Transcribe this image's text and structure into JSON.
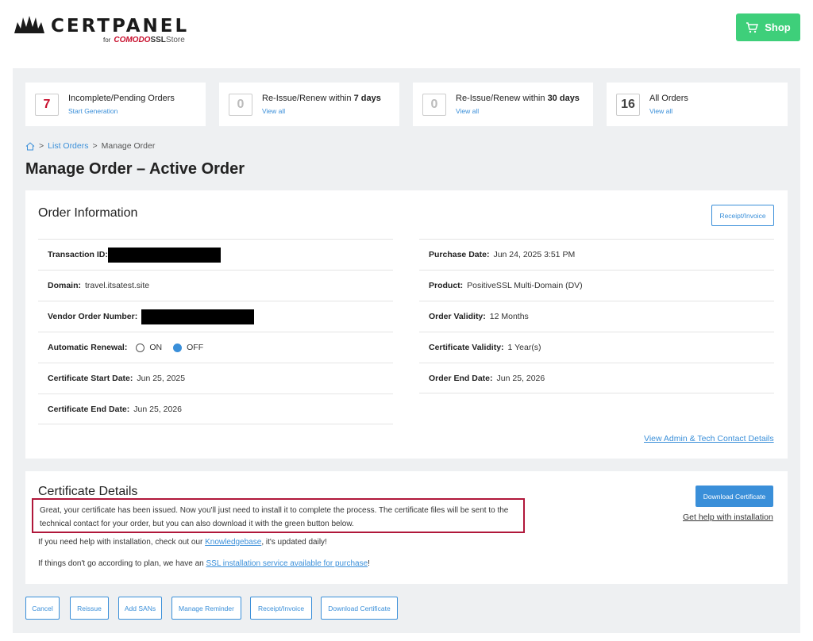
{
  "header": {
    "logo_text": "CERTPANEL",
    "logo_for": "for",
    "logo_comodo": "COMODO",
    "logo_ssl": "SSL",
    "logo_store": "Store",
    "shop_label": "Shop"
  },
  "stats": [
    {
      "count": "7",
      "title": "Incomplete/Pending Orders",
      "title_bold": "",
      "link": "Start Generation"
    },
    {
      "count": "0",
      "title": "Re-Issue/Renew within ",
      "title_bold": "7 days",
      "link": "View all"
    },
    {
      "count": "0",
      "title": "Re-Issue/Renew within ",
      "title_bold": "30 days",
      "link": "View all"
    },
    {
      "count": "16",
      "title": "All Orders",
      "title_bold": "",
      "link": "View all"
    }
  ],
  "breadcrumb": {
    "sep1": ">",
    "list_orders": "List Orders",
    "sep2": ">",
    "current": "Manage Order"
  },
  "page_title": "Manage Order – Active Order",
  "order_info": {
    "title": "Order Information",
    "receipt_label": "Receipt/Invoice",
    "transaction_label": "Transaction ID:",
    "domain_label": "Domain:",
    "domain_value": "travel.itsatest.site",
    "vendor_label": "Vendor Order Number:",
    "renewal_label": "Automatic Renewal:",
    "renewal_on": "ON",
    "renewal_off": "OFF",
    "cert_start_label": "Certificate Start Date:",
    "cert_start_value": "Jun 25, 2025",
    "cert_end_label": "Certificate End Date:",
    "cert_end_value": "Jun 25, 2026",
    "purchase_label": "Purchase Date:",
    "purchase_value": "Jun 24, 2025 3:51 PM",
    "product_label": "Product:",
    "product_value": "PositiveSSL Multi-Domain (DV)",
    "validity_label": "Order Validity:",
    "validity_value": "12 Months",
    "cert_validity_label": "Certificate Validity:",
    "cert_validity_value": "1 Year(s)",
    "order_end_label": "Order End Date:",
    "order_end_value": "Jun 25, 2026",
    "contact_link": "View Admin & Tech Contact Details"
  },
  "cert_details": {
    "title": "Certificate Details",
    "message": "Great, your certificate has been issued. Now you'll just need to install it to complete the process. The certificate files will be sent to the technical contact for your order, but you can also download it with the green button below.",
    "kb_pre": "If you need help with installation, check out our ",
    "kb_link": "Knowledgebase",
    "kb_post": ", it's updated daily!",
    "svc_pre": "If things don't go according to plan, we have an ",
    "svc_link": "SSL installation service available for purchase",
    "svc_post": "!",
    "download_label": "Download Certificate",
    "help_link": "Get help with installation"
  },
  "actions": {
    "cancel": "Cancel",
    "reissue": "Reissue",
    "add_sans": "Add SANs",
    "manage_reminder": "Manage Reminder",
    "receipt": "Receipt/Invoice",
    "download": "Download Certificate"
  },
  "colors": {
    "accent": "#3a8fd9",
    "shop": "#3ecf7a",
    "alert_border": "#b0173a",
    "brand_red": "#c8102e"
  }
}
